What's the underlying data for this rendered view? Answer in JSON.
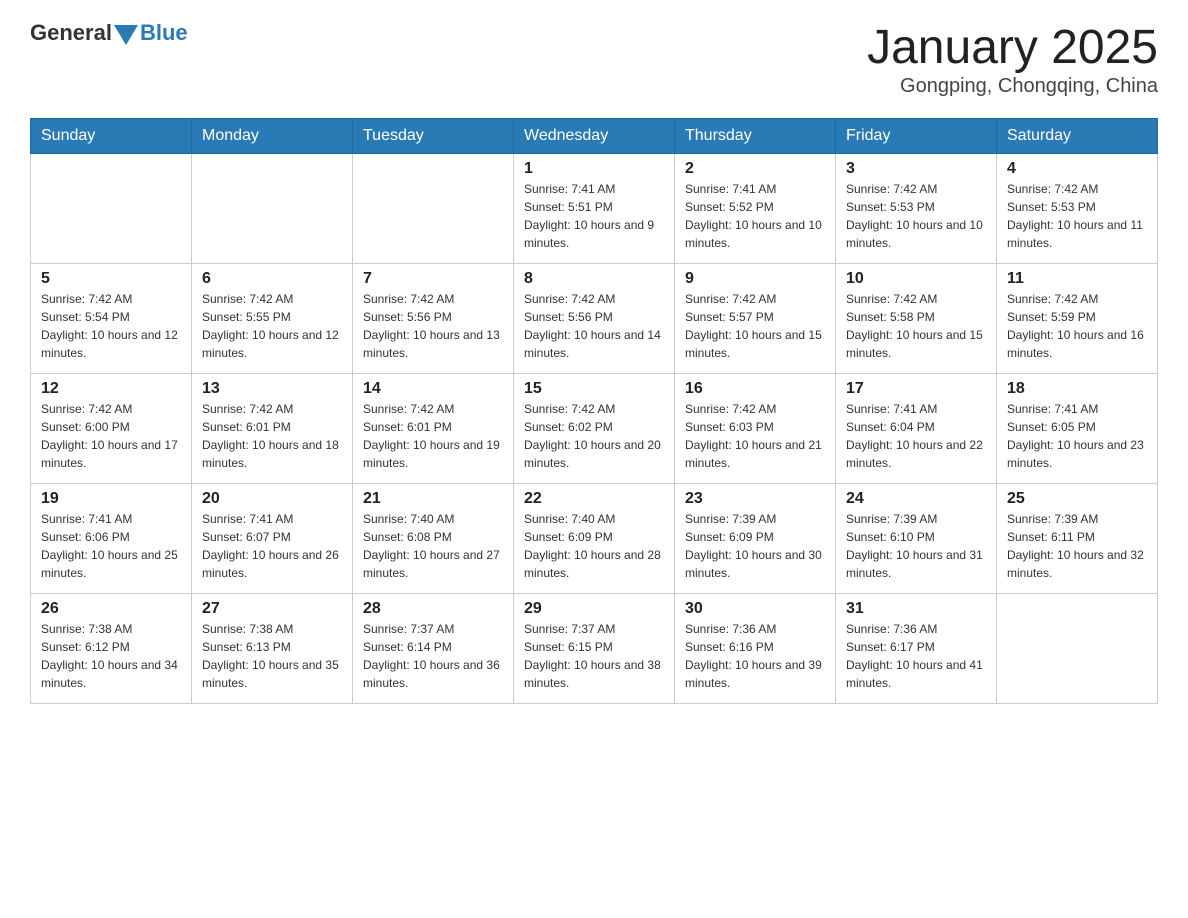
{
  "header": {
    "logo_general": "General",
    "logo_blue": "Blue",
    "title": "January 2025",
    "subtitle": "Gongping, Chongqing, China"
  },
  "days_of_week": [
    "Sunday",
    "Monday",
    "Tuesday",
    "Wednesday",
    "Thursday",
    "Friday",
    "Saturday"
  ],
  "weeks": [
    [
      {
        "day": "",
        "info": ""
      },
      {
        "day": "",
        "info": ""
      },
      {
        "day": "",
        "info": ""
      },
      {
        "day": "1",
        "info": "Sunrise: 7:41 AM\nSunset: 5:51 PM\nDaylight: 10 hours and 9 minutes."
      },
      {
        "day": "2",
        "info": "Sunrise: 7:41 AM\nSunset: 5:52 PM\nDaylight: 10 hours and 10 minutes."
      },
      {
        "day": "3",
        "info": "Sunrise: 7:42 AM\nSunset: 5:53 PM\nDaylight: 10 hours and 10 minutes."
      },
      {
        "day": "4",
        "info": "Sunrise: 7:42 AM\nSunset: 5:53 PM\nDaylight: 10 hours and 11 minutes."
      }
    ],
    [
      {
        "day": "5",
        "info": "Sunrise: 7:42 AM\nSunset: 5:54 PM\nDaylight: 10 hours and 12 minutes."
      },
      {
        "day": "6",
        "info": "Sunrise: 7:42 AM\nSunset: 5:55 PM\nDaylight: 10 hours and 12 minutes."
      },
      {
        "day": "7",
        "info": "Sunrise: 7:42 AM\nSunset: 5:56 PM\nDaylight: 10 hours and 13 minutes."
      },
      {
        "day": "8",
        "info": "Sunrise: 7:42 AM\nSunset: 5:56 PM\nDaylight: 10 hours and 14 minutes."
      },
      {
        "day": "9",
        "info": "Sunrise: 7:42 AM\nSunset: 5:57 PM\nDaylight: 10 hours and 15 minutes."
      },
      {
        "day": "10",
        "info": "Sunrise: 7:42 AM\nSunset: 5:58 PM\nDaylight: 10 hours and 15 minutes."
      },
      {
        "day": "11",
        "info": "Sunrise: 7:42 AM\nSunset: 5:59 PM\nDaylight: 10 hours and 16 minutes."
      }
    ],
    [
      {
        "day": "12",
        "info": "Sunrise: 7:42 AM\nSunset: 6:00 PM\nDaylight: 10 hours and 17 minutes."
      },
      {
        "day": "13",
        "info": "Sunrise: 7:42 AM\nSunset: 6:01 PM\nDaylight: 10 hours and 18 minutes."
      },
      {
        "day": "14",
        "info": "Sunrise: 7:42 AM\nSunset: 6:01 PM\nDaylight: 10 hours and 19 minutes."
      },
      {
        "day": "15",
        "info": "Sunrise: 7:42 AM\nSunset: 6:02 PM\nDaylight: 10 hours and 20 minutes."
      },
      {
        "day": "16",
        "info": "Sunrise: 7:42 AM\nSunset: 6:03 PM\nDaylight: 10 hours and 21 minutes."
      },
      {
        "day": "17",
        "info": "Sunrise: 7:41 AM\nSunset: 6:04 PM\nDaylight: 10 hours and 22 minutes."
      },
      {
        "day": "18",
        "info": "Sunrise: 7:41 AM\nSunset: 6:05 PM\nDaylight: 10 hours and 23 minutes."
      }
    ],
    [
      {
        "day": "19",
        "info": "Sunrise: 7:41 AM\nSunset: 6:06 PM\nDaylight: 10 hours and 25 minutes."
      },
      {
        "day": "20",
        "info": "Sunrise: 7:41 AM\nSunset: 6:07 PM\nDaylight: 10 hours and 26 minutes."
      },
      {
        "day": "21",
        "info": "Sunrise: 7:40 AM\nSunset: 6:08 PM\nDaylight: 10 hours and 27 minutes."
      },
      {
        "day": "22",
        "info": "Sunrise: 7:40 AM\nSunset: 6:09 PM\nDaylight: 10 hours and 28 minutes."
      },
      {
        "day": "23",
        "info": "Sunrise: 7:39 AM\nSunset: 6:09 PM\nDaylight: 10 hours and 30 minutes."
      },
      {
        "day": "24",
        "info": "Sunrise: 7:39 AM\nSunset: 6:10 PM\nDaylight: 10 hours and 31 minutes."
      },
      {
        "day": "25",
        "info": "Sunrise: 7:39 AM\nSunset: 6:11 PM\nDaylight: 10 hours and 32 minutes."
      }
    ],
    [
      {
        "day": "26",
        "info": "Sunrise: 7:38 AM\nSunset: 6:12 PM\nDaylight: 10 hours and 34 minutes."
      },
      {
        "day": "27",
        "info": "Sunrise: 7:38 AM\nSunset: 6:13 PM\nDaylight: 10 hours and 35 minutes."
      },
      {
        "day": "28",
        "info": "Sunrise: 7:37 AM\nSunset: 6:14 PM\nDaylight: 10 hours and 36 minutes."
      },
      {
        "day": "29",
        "info": "Sunrise: 7:37 AM\nSunset: 6:15 PM\nDaylight: 10 hours and 38 minutes."
      },
      {
        "day": "30",
        "info": "Sunrise: 7:36 AM\nSunset: 6:16 PM\nDaylight: 10 hours and 39 minutes."
      },
      {
        "day": "31",
        "info": "Sunrise: 7:36 AM\nSunset: 6:17 PM\nDaylight: 10 hours and 41 minutes."
      },
      {
        "day": "",
        "info": ""
      }
    ]
  ]
}
